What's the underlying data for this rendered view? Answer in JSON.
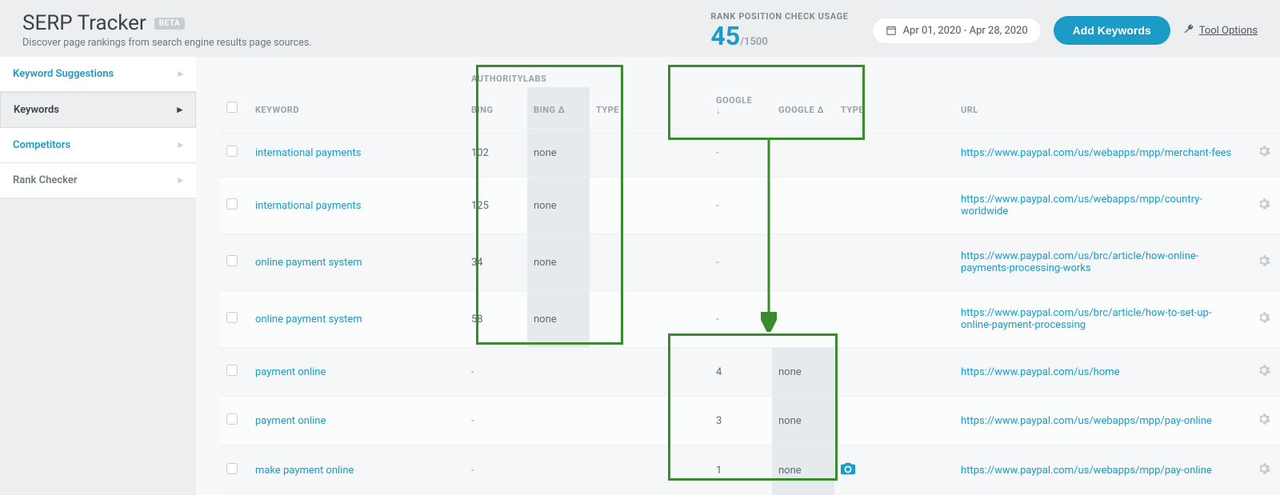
{
  "header": {
    "title": "SERP Tracker",
    "badge": "BETA",
    "subtitle": "Discover page rankings from search engine results page sources.",
    "usage_label": "RANK POSITION CHECK USAGE",
    "usage_value": "45",
    "usage_total": "/1500",
    "date_range": "Apr 01, 2020 - Apr 28, 2020",
    "add_button": "Add Keywords",
    "tool_options": "Tool Options"
  },
  "sidebar": {
    "items": [
      {
        "label": "Keyword Suggestions",
        "active": false
      },
      {
        "label": "Keywords",
        "active": true
      },
      {
        "label": "Competitors",
        "active": false
      },
      {
        "label": "Rank Checker",
        "active": false
      }
    ]
  },
  "table": {
    "group1_label": "AUTHORITYLABS",
    "headers": {
      "keyword": "KEYWORD",
      "bing": "BING",
      "bing_delta": "BING Δ",
      "type1": "TYPE",
      "google": "GOOGLE ↓",
      "google_delta": "GOOGLE Δ",
      "type2": "TYPE",
      "url": "URL"
    },
    "rows": [
      {
        "keyword": "international payments",
        "bing": "102",
        "bing_delta": "none",
        "type1": "",
        "google": "-",
        "google_delta": "",
        "type2": "",
        "url": "https://www.paypal.com/us/webapps/mpp/merchant-fees",
        "camera": false
      },
      {
        "keyword": "international payments",
        "bing": "125",
        "bing_delta": "none",
        "type1": "",
        "google": "-",
        "google_delta": "",
        "type2": "",
        "url": "https://www.paypal.com/us/webapps/mpp/country-worldwide",
        "camera": false
      },
      {
        "keyword": "online payment system",
        "bing": "34",
        "bing_delta": "none",
        "type1": "",
        "google": "-",
        "google_delta": "",
        "type2": "",
        "url": "https://www.paypal.com/us/brc/article/how-online-payments-processing-works",
        "camera": false
      },
      {
        "keyword": "online payment system",
        "bing": "58",
        "bing_delta": "none",
        "type1": "",
        "google": "-",
        "google_delta": "",
        "type2": "",
        "url": "https://www.paypal.com/us/brc/article/how-to-set-up-online-payment-processing",
        "camera": false
      },
      {
        "keyword": "payment online",
        "bing": "-",
        "bing_delta": "",
        "type1": "",
        "google": "4",
        "google_delta": "none",
        "type2": "",
        "url": "https://www.paypal.com/us/home",
        "camera": false
      },
      {
        "keyword": "payment online",
        "bing": "-",
        "bing_delta": "",
        "type1": "",
        "google": "3",
        "google_delta": "none",
        "type2": "",
        "url": "https://www.paypal.com/us/webapps/mpp/pay-online",
        "camera": false
      },
      {
        "keyword": "make payment online",
        "bing": "-",
        "bing_delta": "",
        "type1": "",
        "google": "1",
        "google_delta": "none",
        "type2": "",
        "url": "https://www.paypal.com/us/webapps/mpp/pay-online",
        "camera": true
      }
    ]
  }
}
